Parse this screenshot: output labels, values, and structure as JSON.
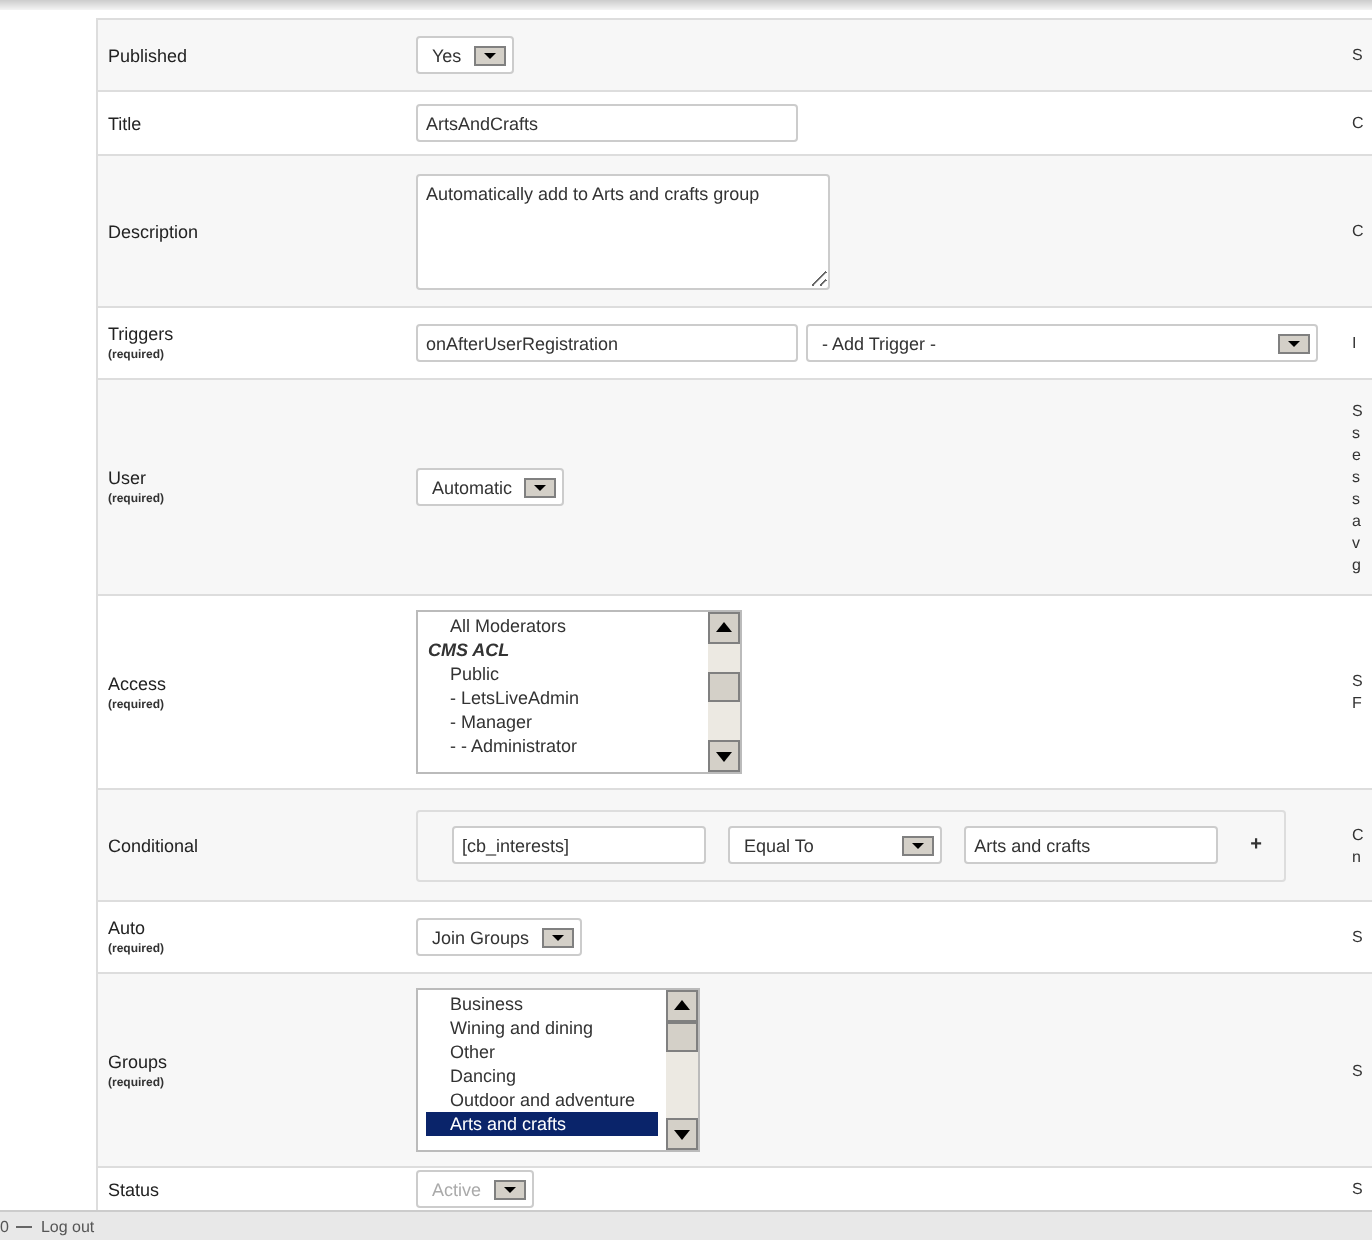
{
  "form": {
    "rows": [
      {
        "kind": "select",
        "label": "Published",
        "value": "Yes",
        "disabled": false,
        "hint_lines": [
          "S"
        ]
      },
      {
        "kind": "text",
        "label": "Title",
        "value": "ArtsAndCrafts",
        "hint_lines": [
          "C"
        ]
      },
      {
        "kind": "textarea",
        "label": "Description",
        "value": "Automatically add to Arts and crafts group",
        "hint_lines": [
          "C"
        ]
      },
      {
        "kind": "text_select",
        "label": "Triggers",
        "note": "(required)",
        "value": "onAfterUserRegistration",
        "select": "- Add Trigger -",
        "hint_lines": [
          "I"
        ]
      },
      {
        "kind": "select",
        "label": "User",
        "note": "(required)",
        "value": "Automatic",
        "disabled": false,
        "hint_lines": [
          "S",
          "s",
          "e",
          "s",
          "s",
          "a",
          "v",
          "g"
        ]
      },
      {
        "kind": "listbox",
        "label": "Access",
        "note": "(required)",
        "items": [
          {
            "kind": "option",
            "text": "All Moderators",
            "selected": false
          },
          {
            "kind": "group",
            "text": "CMS ACL",
            "selected": false
          },
          {
            "kind": "option",
            "text": "Public",
            "selected": false
          },
          {
            "kind": "option",
            "text": "- LetsLiveAdmin",
            "selected": false
          },
          {
            "kind": "option",
            "text": "- Manager",
            "selected": false
          },
          {
            "kind": "option",
            "text": "- - Administrator",
            "selected": false
          }
        ],
        "hint_lines": [
          "S",
          "F"
        ]
      },
      {
        "kind": "conditional",
        "label": "Conditional",
        "field": "[cb_interests]",
        "operator": "Equal To",
        "value": "Arts and crafts",
        "add": "+",
        "hint_lines": [
          "C",
          "n"
        ]
      },
      {
        "kind": "select",
        "label": "Auto",
        "note": "(required)",
        "value": "Join Groups",
        "disabled": false,
        "hint_lines": [
          "S"
        ]
      },
      {
        "kind": "listbox",
        "label": "Groups",
        "note": "(required)",
        "items": [
          {
            "kind": "option",
            "text": "Business",
            "selected": false
          },
          {
            "kind": "option",
            "text": "Wining and dining",
            "selected": false
          },
          {
            "kind": "option",
            "text": "Other",
            "selected": false
          },
          {
            "kind": "option",
            "text": "Dancing",
            "selected": false
          },
          {
            "kind": "option",
            "text": "Outdoor and adventure",
            "selected": false
          },
          {
            "kind": "option",
            "text": "Arts and crafts",
            "selected": true
          }
        ],
        "hint_lines": [
          "S"
        ]
      },
      {
        "kind": "select",
        "label": "Status",
        "value": "Active",
        "disabled": true,
        "hint_lines": [
          "S"
        ]
      }
    ]
  },
  "footer": {
    "count": "0",
    "logout": "Log out"
  }
}
